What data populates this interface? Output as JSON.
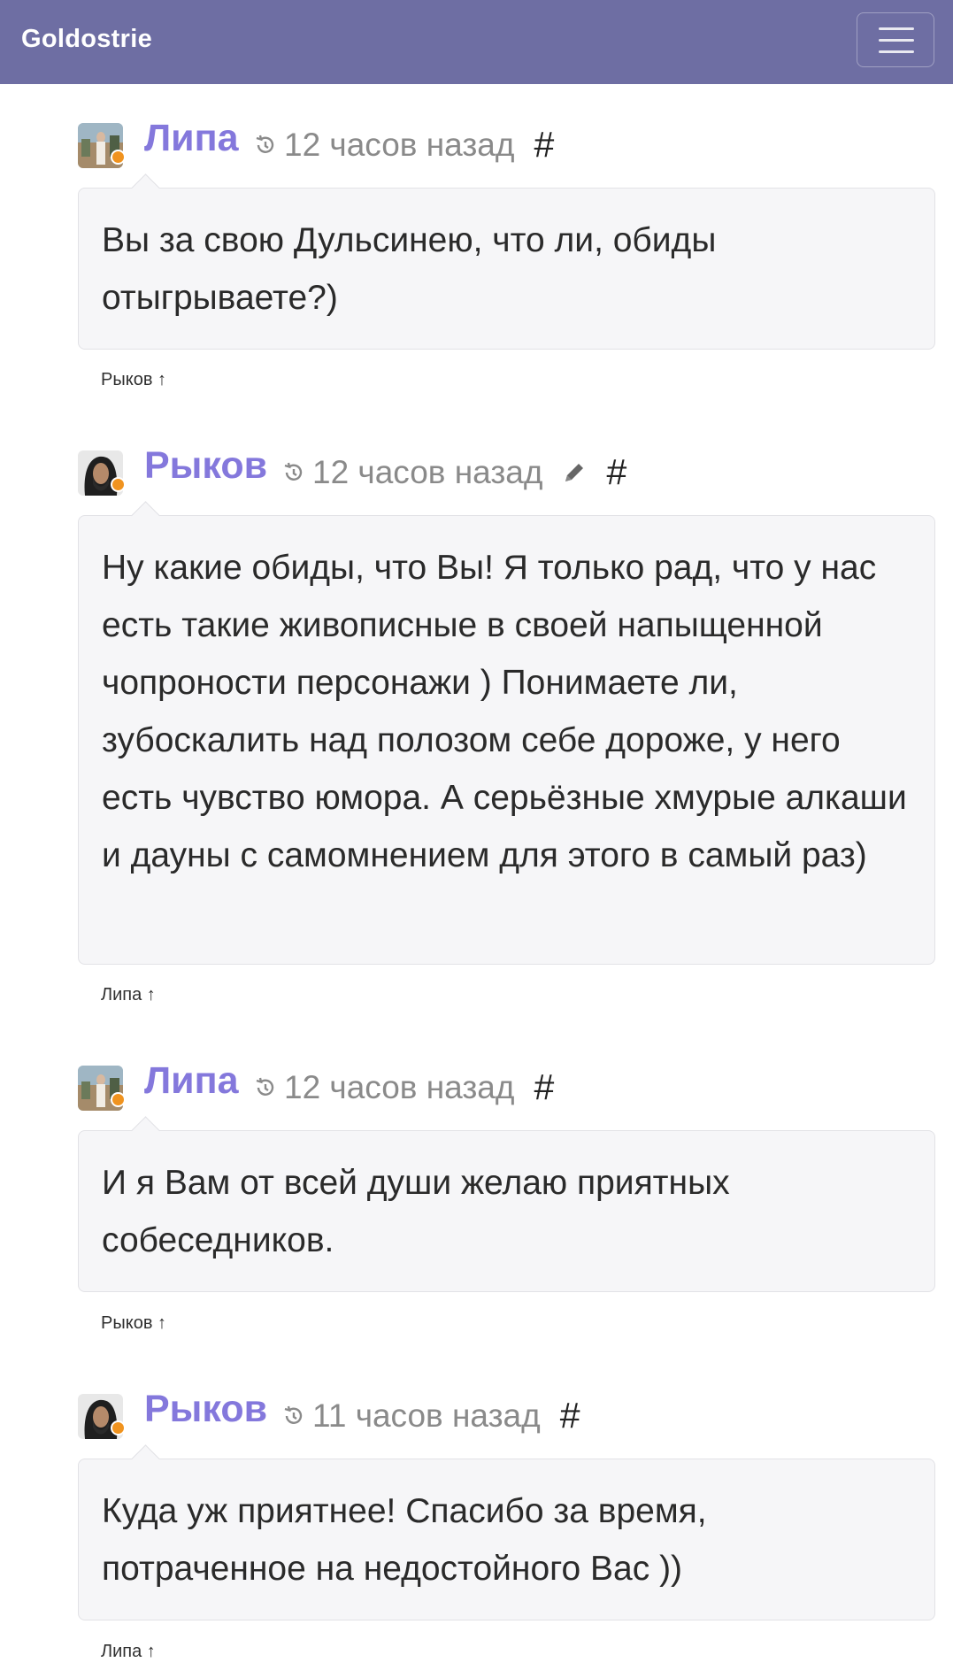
{
  "navbar": {
    "brand": "Goldostrie",
    "menu_icon": "hamburger-menu-icon"
  },
  "colors": {
    "navbar": "#6e6ea3",
    "author": "#8478dc",
    "status_dot": "#f0931f",
    "bubble_bg": "#f6f6f8"
  },
  "comments": [
    {
      "author": "Липа",
      "time": "12 часов назад",
      "hash": "#",
      "editable": false,
      "text": "Вы за свою Дульсинею, что ли, обиды отыгрываете?)",
      "reply_to": "Рыков ↑"
    },
    {
      "author": "Рыков",
      "time": "12 часов назад",
      "hash": "#",
      "editable": true,
      "text": "Ну какие обиды, что Вы! Я только рад, что у нас есть такие живописные в своей напыщенной чопроности персонажи ) Понимаете ли, зубоскалить над полозом себе дороже, у него есть чувство юмора. А серьёзные хмурые алкаши и дауны с самомнением для этого в самый раз)",
      "reply_to": "Липа ↑"
    },
    {
      "author": "Липа",
      "time": "12 часов назад",
      "hash": "#",
      "editable": false,
      "text": "И я Вам от всей души желаю приятных собеседников.",
      "reply_to": "Рыков ↑"
    },
    {
      "author": "Рыков",
      "time": "11 часов назад",
      "hash": "#",
      "editable": false,
      "text": "Куда уж приятнее! Спасибо за время, потраченное на недостойного Вас ))",
      "reply_to": "Липа ↑"
    }
  ]
}
